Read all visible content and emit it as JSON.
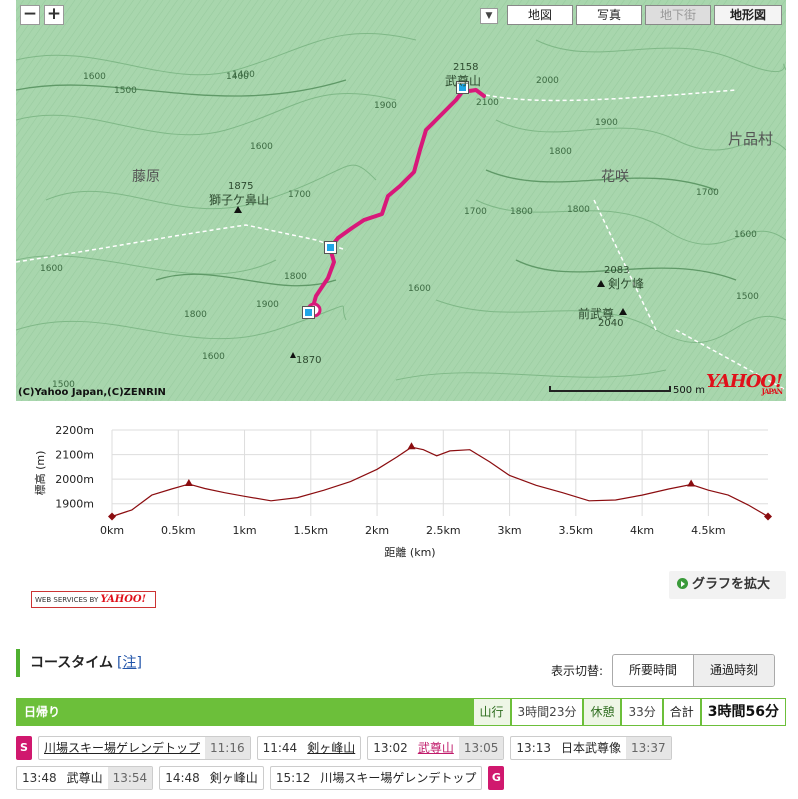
{
  "map": {
    "zoom_out": "−",
    "zoom_in": "+",
    "layers_dropdown": "▼",
    "types": [
      {
        "label": "地図",
        "state": "normal"
      },
      {
        "label": "写真",
        "state": "normal"
      },
      {
        "label": "地下街",
        "state": "disabled"
      },
      {
        "label": "地形図",
        "state": "active"
      }
    ],
    "places": {
      "takeru": "武尊山",
      "takeru_elev": "2158",
      "shishigahana": "獅子ケ鼻山",
      "shishigahana_elev": "1875",
      "tsurugigamine": "剣ケ峰",
      "tsurugigamine_elev": "2083",
      "maehotaka": "前武尊",
      "maehotaka_elev": "2040",
      "fujiwara": "藤原",
      "hanasaki": "花咲",
      "katashina": "片品村",
      "peak1870": "1870"
    },
    "contours": [
      "1600",
      "1500",
      "1400",
      "1700",
      "1600",
      "1800",
      "1900",
      "2000",
      "2100",
      "1800",
      "1900",
      "1700",
      "1600",
      "1800",
      "1800",
      "1600",
      "1700",
      "1500",
      "1500",
      "1600",
      "1400",
      "1600",
      "1900",
      "1800"
    ],
    "copyright": "(C)Yahoo Japan,(C)ZENRIN",
    "scale_label": "500 m",
    "logo": "YAHOO!",
    "logo_sub": "JAPAN",
    "route_color": "#d8187a"
  },
  "chart_data": {
    "type": "area",
    "title": "",
    "xlabel": "距離 (km)",
    "ylabel": "標高 (m)",
    "xlim": [
      0,
      4.95
    ],
    "ylim": [
      1850,
      2200
    ],
    "x_ticks": [
      "0km",
      "0.5km",
      "1km",
      "1.5km",
      "2km",
      "2.5km",
      "3km",
      "3.5km",
      "4km",
      "4.5km"
    ],
    "y_ticks": [
      "2200m",
      "2100m",
      "2000m",
      "1900m"
    ],
    "series": [
      {
        "x": [
          0,
          0.15,
          0.3,
          0.45,
          0.58,
          0.7,
          0.85,
          1.0,
          1.2,
          1.4,
          1.6,
          1.8,
          2.0,
          2.15,
          2.26,
          2.35,
          2.45,
          2.55,
          2.7,
          2.85,
          3.0,
          3.2,
          3.4,
          3.6,
          3.8,
          4.0,
          4.2,
          4.37,
          4.5,
          4.65,
          4.8,
          4.95
        ],
        "y": [
          1848,
          1875,
          1935,
          1960,
          1980,
          1962,
          1945,
          1930,
          1912,
          1925,
          1955,
          1990,
          2040,
          2090,
          2130,
          2120,
          2095,
          2115,
          2120,
          2070,
          2015,
          1975,
          1945,
          1912,
          1915,
          1935,
          1960,
          1978,
          1955,
          1935,
          1895,
          1848
        ]
      }
    ],
    "markers": [
      {
        "x": 0,
        "y": 1848,
        "shape": "diamond"
      },
      {
        "x": 0.58,
        "y": 1980,
        "shape": "triangle"
      },
      {
        "x": 2.26,
        "y": 2130,
        "shape": "triangle"
      },
      {
        "x": 4.37,
        "y": 1978,
        "shape": "triangle"
      },
      {
        "x": 4.95,
        "y": 1848,
        "shape": "diamond"
      }
    ],
    "colors": {
      "line": "#8b0d10",
      "grid": "#dddddd"
    }
  },
  "badge": {
    "text": "WEB SERVICES BY",
    "brand": "YAHOO!"
  },
  "expand_graph": "グラフを拡大",
  "course": {
    "heading": "コースタイム",
    "note": "[注]",
    "display_switch_label": "表示切替:",
    "toggle_required": "所要時間",
    "toggle_passing": "通過時刻",
    "summary": {
      "title": "日帰り",
      "walk_label": "山行",
      "walk_value": "3時間23分",
      "rest_label": "休憩",
      "rest_value": "33分",
      "total_label": "合計",
      "total_value": "3時間56分"
    },
    "start_marker": "S",
    "goal_marker": "G",
    "row1": [
      {
        "pre": "",
        "place": "川場スキー場ゲレンデトップ",
        "post": "11:16",
        "style": "link"
      },
      {
        "pre": "11:44",
        "place": "剣ヶ峰山",
        "post": "",
        "style": "link"
      },
      {
        "pre": "13:02",
        "place": "武尊山",
        "post": "13:05",
        "style": "pink"
      },
      {
        "pre": "13:13",
        "place": "日本武尊像",
        "post": "13:37",
        "style": "plain"
      }
    ],
    "row2": [
      {
        "pre": "13:48",
        "place": "武尊山",
        "post": "13:54",
        "style": "plain"
      },
      {
        "pre": "14:48",
        "place": "剣ヶ峰山",
        "post": "",
        "style": "plain"
      },
      {
        "pre": "15:12",
        "place": "川場スキー場ゲレンデトップ",
        "post": "",
        "style": "plain"
      }
    ]
  }
}
